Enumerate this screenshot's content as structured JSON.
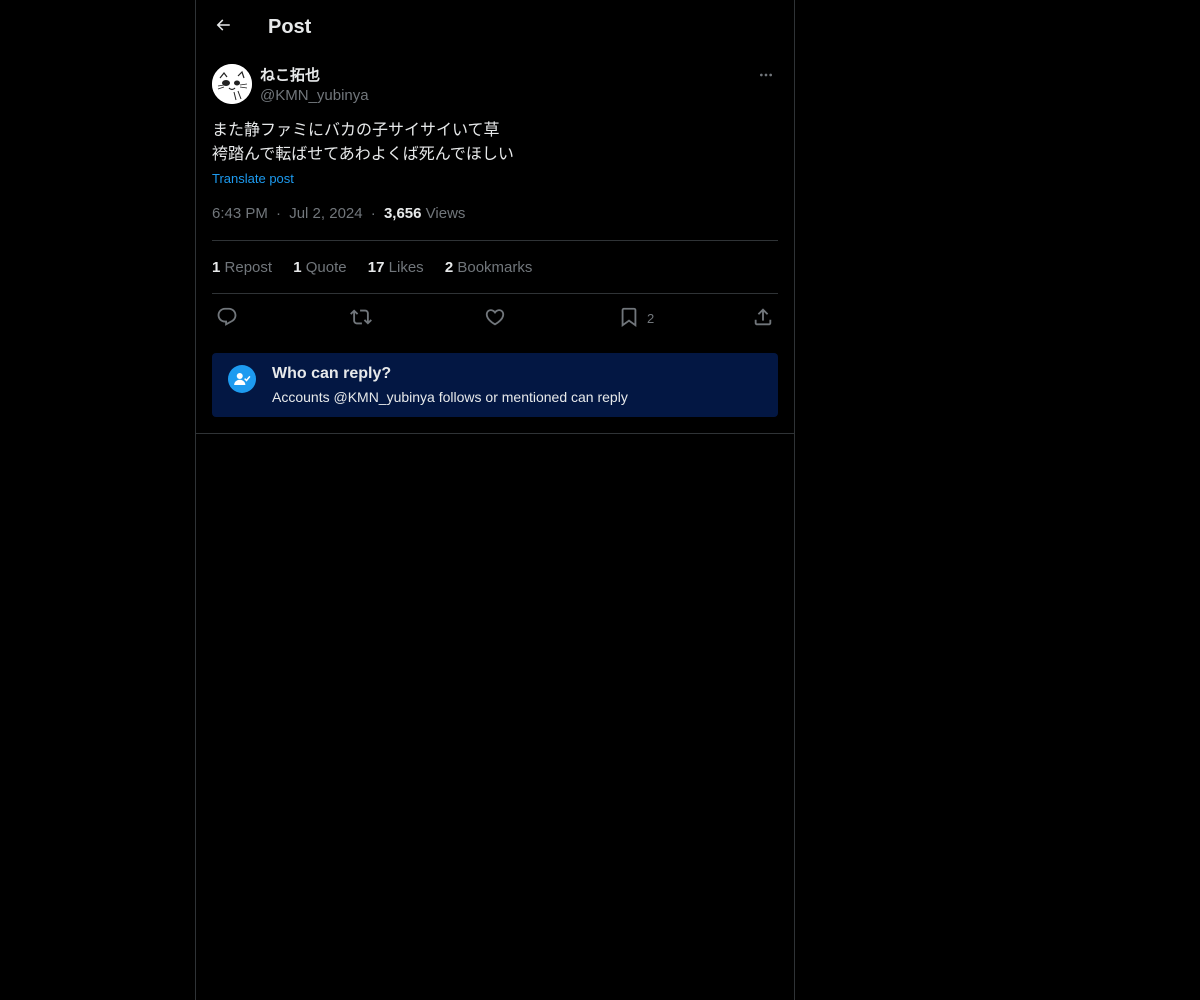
{
  "header": {
    "back_icon": "arrow-left-icon",
    "title": "Post"
  },
  "author": {
    "name": "ねこ拓也",
    "handle": "@KMN_yubinya",
    "avatar_icon": "cat-avatar"
  },
  "post": {
    "text": "また静ファミにバカの子サイサイいて草\n袴踏んで転ばせてあわよくば死んでほしい",
    "translate_label": "Translate post",
    "time": "6:43 PM",
    "date": "Jul 2, 2024",
    "separator": "·",
    "views_count": "3,656",
    "views_label": "Views"
  },
  "stats": [
    {
      "num": "1",
      "label": "Repost"
    },
    {
      "num": "1",
      "label": "Quote"
    },
    {
      "num": "17",
      "label": "Likes"
    },
    {
      "num": "2",
      "label": "Bookmarks"
    }
  ],
  "actions": {
    "reply_icon": "reply-icon",
    "repost_icon": "repost-icon",
    "like_icon": "heart-icon",
    "bookmark_icon": "bookmark-icon",
    "bookmark_count": "2",
    "share_icon": "share-icon"
  },
  "reply_restriction": {
    "icon": "user-check-icon",
    "title": "Who can reply?",
    "description": "Accounts @KMN_yubinya follows or mentioned can reply"
  },
  "colors": {
    "background": "#000000",
    "text": "#e7e9ea",
    "secondary": "#71767b",
    "accent": "#1d9bf0",
    "border": "#2f3336",
    "reply_box": "#031743"
  }
}
